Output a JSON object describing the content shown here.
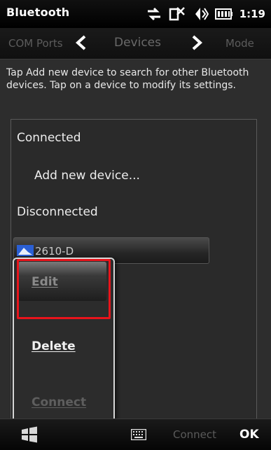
{
  "statusbar": {
    "app_title": "Bluetooth",
    "time": "1:19",
    "icons": [
      "data-transfer-icon",
      "signal-off-icon",
      "volume-icon",
      "battery-icon"
    ]
  },
  "tabs": {
    "left": "COM Ports",
    "center": "Devices",
    "right": "Mode"
  },
  "instructions": "Tap Add new device to search for other Bluetooth devices. Tap on a device to modify its settings.",
  "list": {
    "connected_header": "Connected",
    "add_new_device": "Add new device...",
    "disconnected_header": "Disconnected",
    "device_name": "2610-D"
  },
  "context_menu": {
    "edit": "Edit",
    "delete": "Delete",
    "connect": "Connect"
  },
  "bottombar": {
    "left_softkey": "Connect",
    "right_softkey": "OK"
  },
  "colors": {
    "highlight_outline": "#e8141b",
    "background": "#2d2d2d",
    "text": "#ededed",
    "disabled_text": "#5e5e5e"
  }
}
